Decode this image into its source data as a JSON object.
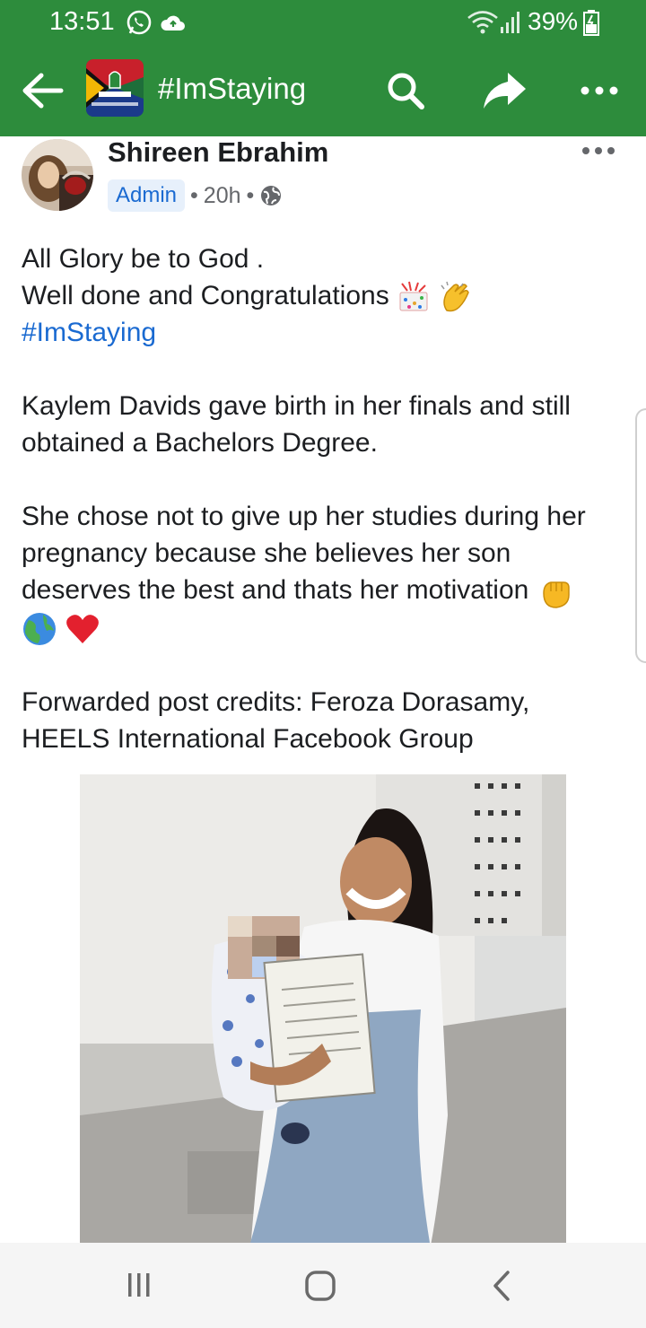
{
  "status_bar": {
    "time": "13:51",
    "battery": "39%"
  },
  "app_bar": {
    "title": "#ImStaying"
  },
  "post": {
    "author": "Shireen Ebrahim",
    "badge": "Admin",
    "time": "20h",
    "lines": {
      "l1": "All Glory be to God .",
      "l2": "Well done and Congratulations",
      "hashtag": "#ImStaying",
      "p2": "Kaylem Davids gave birth in her finals and still obtained a Bachelors Degree.",
      "p3": "She chose not to give up her studies during her pregnancy because she believes her son deserves the best and thats her motivation",
      "p4": "Forwarded post credits: Feroza Dorasamy, HEELS International Facebook Group"
    }
  },
  "colors": {
    "brand_green": "#2d8c3c",
    "link_blue": "#1a6ad1"
  },
  "icons": [
    "whatsapp-icon",
    "cloud-icon",
    "wifi-icon",
    "signal-icon",
    "battery-icon",
    "back-arrow-icon",
    "search-icon",
    "share-icon",
    "more-icon",
    "globe-icon",
    "party-popper-icon",
    "clapping-hands-icon",
    "raised-fist-icon",
    "globe-earth-icon",
    "red-heart-icon",
    "recent-apps-icon",
    "home-icon",
    "back-nav-icon"
  ]
}
